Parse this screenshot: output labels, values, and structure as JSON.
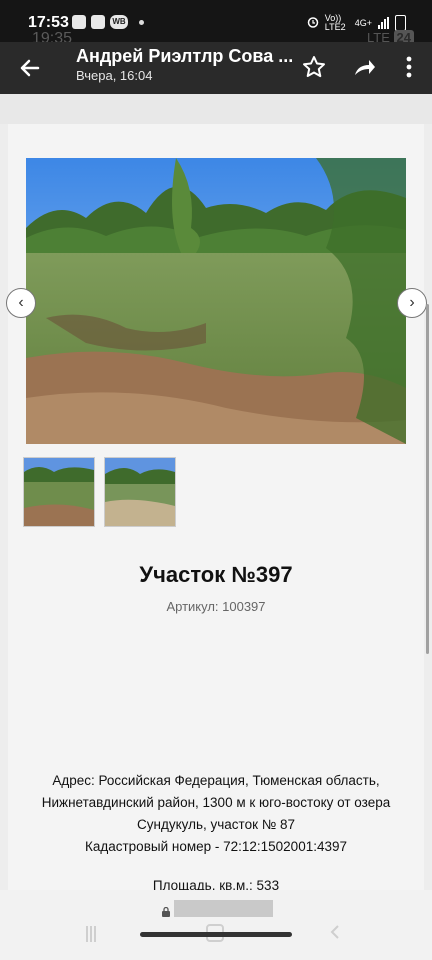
{
  "status_bar": {
    "time": "17:53",
    "ghost_time": "19:35",
    "notif_wb": "WB",
    "carrier_volte": "Vo)) LTE2",
    "network": "4G+",
    "ghost_lte": "LTE",
    "ghost_badge": "24"
  },
  "app_bar": {
    "title": "Андрей Риэлтлр Сова ...",
    "subtitle": "Вчера, 16:04",
    "icons": [
      "back-arrow-icon",
      "star-icon",
      "share-icon",
      "more-vert-icon"
    ]
  },
  "listing": {
    "title": "Участок №397",
    "article": "Артикул: 100397",
    "address_line1": "Адрес: Российская Федерация, Тюменская область,",
    "address_line2": "Нижнетавдинский район, 1300 м к юго-востоку от озера",
    "address_line3": "Сундукуль, участок № 87",
    "cadastral": "Кадастровый номер - 72:12:1502001:4397",
    "area": "Площадь, кв.м.: 533",
    "gallery_prev": "‹",
    "gallery_next": "›"
  },
  "colors": {
    "app_bar": "#2a2a2a",
    "status_bar": "#151515",
    "page_bg": "#f4f4f4"
  }
}
